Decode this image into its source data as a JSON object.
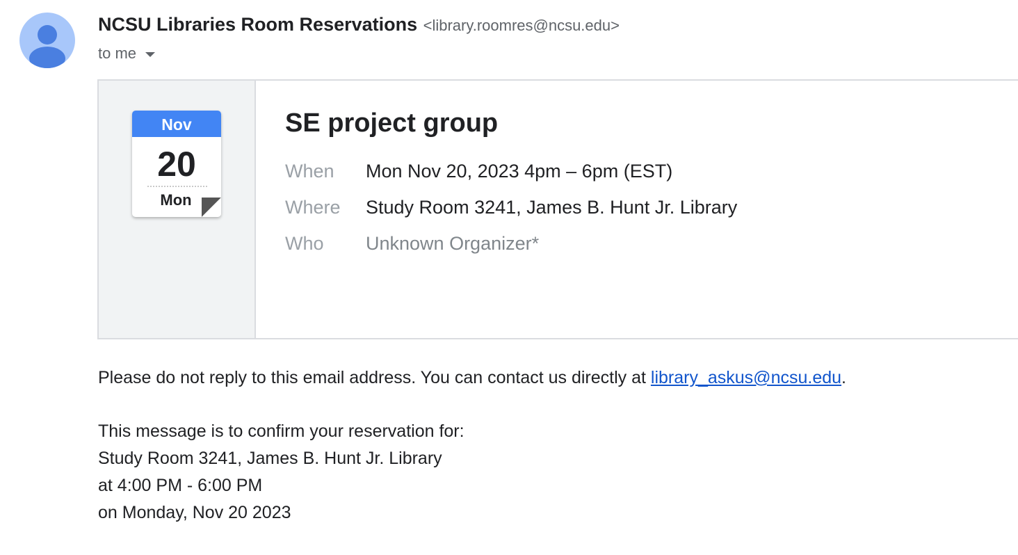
{
  "sender": {
    "name": "NCSU Libraries Room Reservations",
    "email": "<library.roomres@ncsu.edu>"
  },
  "recipient": {
    "label": "to me"
  },
  "event_card": {
    "calendar_icon": {
      "month": "Nov",
      "day": "20",
      "weekday": "Mon"
    },
    "title": "SE project group",
    "rows": [
      {
        "label": "When",
        "value": "Mon Nov 20, 2023 4pm – 6pm (EST)"
      },
      {
        "label": "Where",
        "value": "Study Room 3241, James B. Hunt Jr. Library"
      },
      {
        "label": "Who",
        "value": "Unknown Organizer*"
      }
    ]
  },
  "message": {
    "notice_prefix": "Please do not reply to this email address. You can contact us directly at ",
    "notice_link": "library_askus@ncsu.edu",
    "notice_suffix": ".",
    "lines": [
      "This message is to confirm your reservation for:",
      "Study Room 3241, James B. Hunt Jr. Library",
      "at 4:00 PM - 6:00 PM",
      "on Monday, Nov 20 2023"
    ]
  },
  "colors": {
    "calendar_header": "#4285f4",
    "link": "#1155cc",
    "avatar_bg": "#a8c7fa",
    "avatar_fg": "#4a7fe0"
  }
}
